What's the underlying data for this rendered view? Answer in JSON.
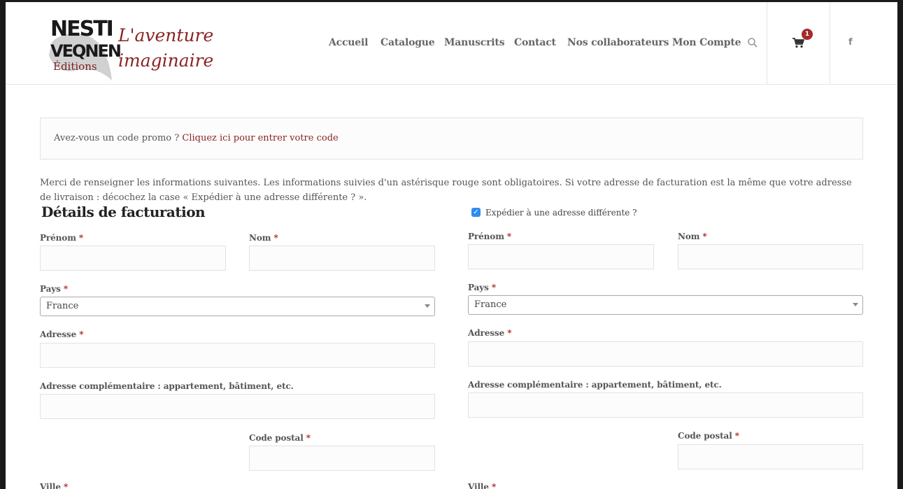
{
  "brand": {
    "logo_line1": "NESTI",
    "logo_line2": "VEQNEN",
    "logo_line3": "Éditions",
    "tagline1": "L'aventure",
    "tagline2": "imaginaire"
  },
  "nav": {
    "items": [
      {
        "label": "Accueil"
      },
      {
        "label": "Catalogue"
      },
      {
        "label": "Manuscrits"
      },
      {
        "label": "Contact"
      },
      {
        "label": "Nos collaborateurs"
      },
      {
        "label": "Mon Compte"
      }
    ],
    "cart_count": "1",
    "facebook_label": "f"
  },
  "coupon": {
    "question": "Avez-vous un code promo ?",
    "link": "Cliquez ici pour entrer votre code"
  },
  "intro": "Merci de renseigner les informations suivantes. Les informations suivies d'un astérisque rouge sont obligatoires. Si votre adresse de facturation est la même que votre adresse de livraison : décochez la case « Expédier à une adresse différente ? ».",
  "billing": {
    "title": "Détails de facturation",
    "first_name_label": "Prénom",
    "last_name_label": "Nom",
    "country_label": "Pays",
    "country_value": "France",
    "address_label": "Adresse",
    "address2_label": "Adresse complémentaire : appartement, bâtiment, etc.",
    "postcode_label": "Code postal",
    "city_label": "Ville"
  },
  "shipping": {
    "checkbox_label": "Expédier à une adresse différente ?",
    "checked": true,
    "first_name_label": "Prénom",
    "last_name_label": "Nom",
    "country_label": "Pays",
    "country_value": "France",
    "address_label": "Adresse",
    "address2_label": "Adresse complémentaire : appartement, bâtiment, etc.",
    "postcode_label": "Code postal",
    "city_label": "Ville"
  },
  "required_mark": "*",
  "colors": {
    "accent": "#8b2323",
    "badge": "#a52a2a",
    "checkbox": "#2d8cf0"
  }
}
